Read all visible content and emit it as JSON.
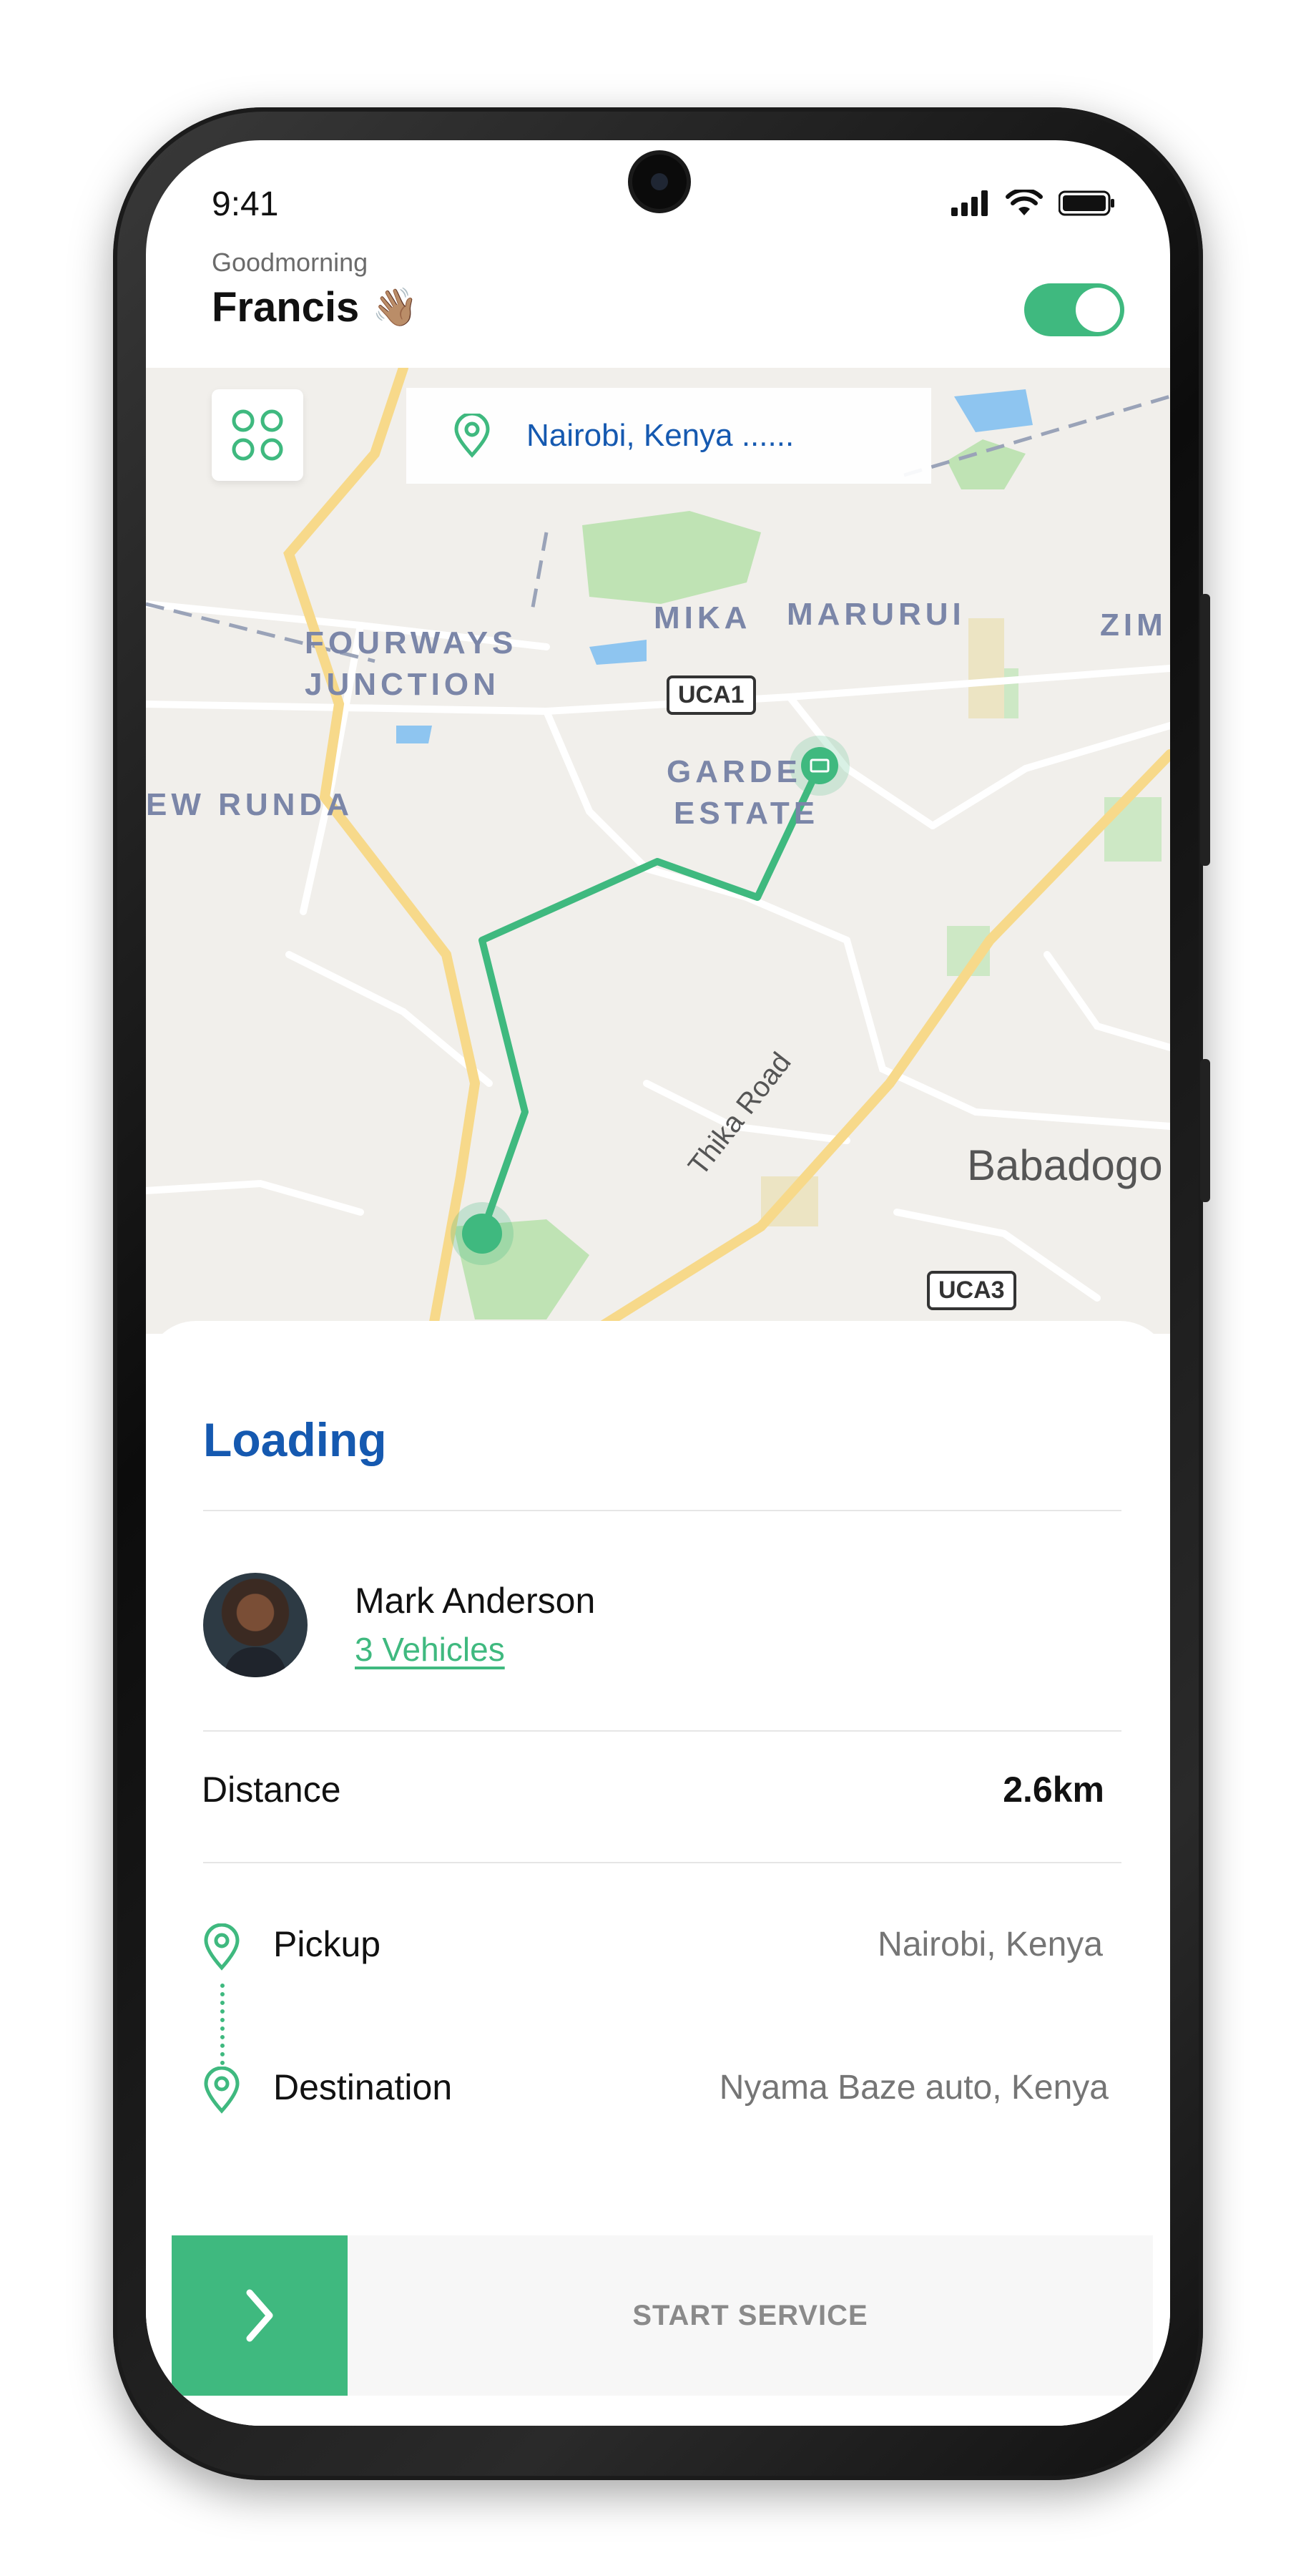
{
  "status_bar": {
    "time": "9:41",
    "icons": [
      "signal-icon",
      "wifi-icon",
      "battery-icon"
    ]
  },
  "header": {
    "greeting": "Goodmorning",
    "name": "Francis",
    "emoji": "👋🏽",
    "toggle_on": true
  },
  "map": {
    "search_text": "Nairobi, Kenya ......",
    "labels": [
      "FOURWAYS",
      "JUNCTION",
      "MIKA",
      "MARURUI",
      "ZIM",
      "GARDE",
      "ESTATE",
      "EW RUNDA",
      "Babadogo",
      "Thika Road"
    ],
    "road_badges": [
      "UCA1",
      "UCA3"
    ]
  },
  "card": {
    "status": "Loading",
    "driver": {
      "name": "Mark Anderson",
      "vehicles": "3 Vehicles"
    },
    "distance": {
      "label": "Distance",
      "value": "2.6km"
    },
    "pickup": {
      "label": "Pickup",
      "value": "Nairobi, Kenya"
    },
    "destination": {
      "label": "Destination",
      "value": "Nyama Baze auto, Kenya"
    },
    "action": "START SERVICE"
  },
  "colors": {
    "accent": "#3fb97f",
    "primary": "#1559b0",
    "map_bg": "#f1efeb",
    "road": "#f7d98a"
  }
}
